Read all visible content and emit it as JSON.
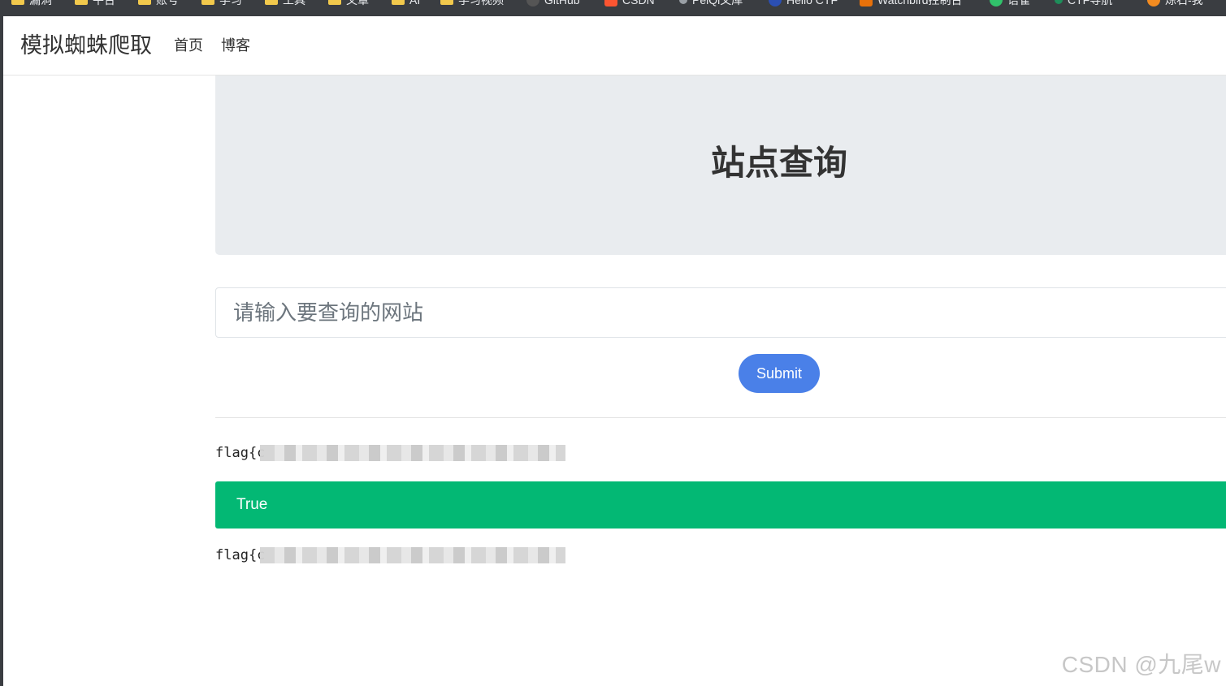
{
  "bookmarks": [
    {
      "label": "漏洞",
      "icon": "folder-icon"
    },
    {
      "label": "平台",
      "icon": "folder-icon"
    },
    {
      "label": "账号",
      "icon": "folder-icon"
    },
    {
      "label": "学习",
      "icon": "folder-icon"
    },
    {
      "label": "工具",
      "icon": "folder-icon"
    },
    {
      "label": "文章",
      "icon": "folder-icon"
    },
    {
      "label": "AI",
      "icon": "folder-icon"
    },
    {
      "label": "学习视频",
      "icon": "folder-icon"
    },
    {
      "label": "GitHub",
      "icon": "github-icon"
    },
    {
      "label": "CSDN",
      "icon": "csdn-icon"
    },
    {
      "label": "PeiQi文库",
      "icon": "pen-icon"
    },
    {
      "label": "Hello CTF",
      "icon": "hello-ctf-icon"
    },
    {
      "label": "Watchbird控制台",
      "icon": "cart-icon"
    },
    {
      "label": "语雀",
      "icon": "yuque-icon"
    },
    {
      "label": "CTF导航",
      "icon": "leaf-icon"
    },
    {
      "label": "炼石-我",
      "icon": "flame-icon"
    }
  ],
  "navbar": {
    "brand": "模拟蜘蛛爬取",
    "links": [
      "首页",
      "博客"
    ]
  },
  "jumbotron": {
    "title": "站点查询"
  },
  "form": {
    "url_placeholder": "请输入要查询的网站",
    "url_value": "",
    "submit_label": "Submit"
  },
  "results": {
    "flag_top_visible": "flag{c",
    "status": "True",
    "flag_bottom_visible": "flag{c"
  },
  "watermark": "CSDN @九尾w",
  "colors": {
    "jumbotron_bg": "#e9ecef",
    "submit_bg": "#4a80e8",
    "success_bg": "#03b874",
    "text": "#333333"
  }
}
